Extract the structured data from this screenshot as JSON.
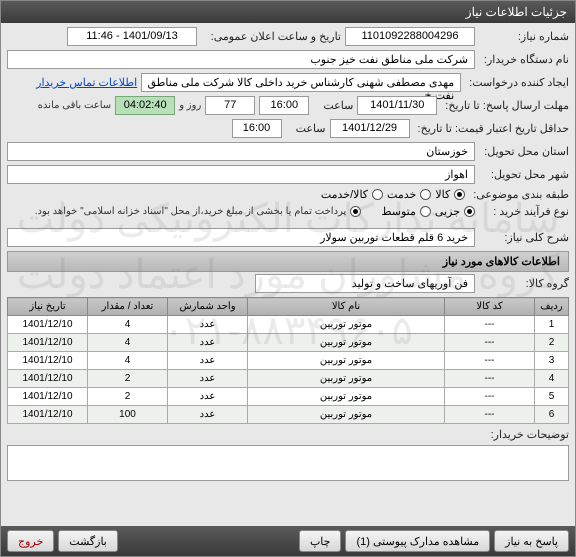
{
  "window_title": "جزئیات اطلاعات نیاز",
  "watermark_line1": "سامانه تدارکات الکترونیکی دولت",
  "watermark_line2": "گروه مشاوران مورد اعتماد دولت",
  "watermark_line3": "۰۲۱-۸۸۳۴۹۶۰۵",
  "labels": {
    "need_no": "شماره نیاز:",
    "public_date": "تاریخ و ساعت اعلان عمومی:",
    "buyer_org": "نام دستگاه خریدار:",
    "requester": "ایجاد کننده درخواست:",
    "deadline": "مهلت ارسال پاسخ: تا تاریخ:",
    "validity": "حداقل تاریخ اعتبار قیمت: تا تاریخ:",
    "province": "استان محل تحویل:",
    "city": "شهر محل تحویل:",
    "classification": "طبقه بندی موضوعی:",
    "buy_type": "نوع فرآیند خرید :",
    "need_summary": "شرح کلی نیاز:",
    "goods_group": "گروه کالا:",
    "buyer_notes": "توضیحات خریدار:",
    "hour": "ساعت",
    "day": "روز و",
    "remaining": "ساعت باقی مانده",
    "contact_link": "اطلاعات تماس خریدار",
    "payment_note": "پرداخت تمام یا بخشی از مبلغ خرید،از محل \"اسناد خزانه اسلامی\" خواهد بود."
  },
  "values": {
    "need_no": "1101092288004296",
    "public_date": "1401/09/13 - 11:46",
    "buyer_org": "شرکت ملی مناطق نفت خیز جنوب",
    "requester": "مهدی  مصطفی شهنی کارشناس خرید داخلی کالا  شرکت ملی مناطق نفت خ",
    "deadline_date": "1401/11/30",
    "deadline_time": "16:00",
    "days_remain": "77",
    "time_remain": "04:02:40",
    "validity_date": "1401/12/29",
    "validity_time": "16:00",
    "province": "خوزستان",
    "city": "اهواز",
    "need_summary": "خرید 6 قلم قطعات توربین سولار",
    "goods_group": "فن آوریهای ساخت و تولید"
  },
  "radios": {
    "kala": "کالا",
    "service": "خدمت",
    "kala_service": "کالا/خدمت",
    "partial": "جزیی",
    "medium": "متوسط"
  },
  "goods_section": "اطلاعات کالاهای مورد نیاز",
  "table": {
    "headers": [
      "ردیف",
      "کد کالا",
      "نام کالا",
      "واحد شمارش",
      "تعداد / مقدار",
      "تاریخ نیاز"
    ],
    "rows": [
      [
        "1",
        "---",
        "موتور توربین",
        "عدد",
        "4",
        "1401/12/10"
      ],
      [
        "2",
        "---",
        "موتور توربین",
        "عدد",
        "4",
        "1401/12/10"
      ],
      [
        "3",
        "---",
        "موتور توربین",
        "عدد",
        "4",
        "1401/12/10"
      ],
      [
        "4",
        "---",
        "موتور توربین",
        "عدد",
        "2",
        "1401/12/10"
      ],
      [
        "5",
        "---",
        "موتور توربین",
        "عدد",
        "2",
        "1401/12/10"
      ],
      [
        "6",
        "---",
        "موتور توربین",
        "عدد",
        "100",
        "1401/12/10"
      ]
    ]
  },
  "buttons": {
    "reply": "پاسخ به نیاز",
    "attachments": "مشاهده مدارک پیوستی (1)",
    "print": "چاپ",
    "back": "بازگشت",
    "exit": "خروج"
  }
}
